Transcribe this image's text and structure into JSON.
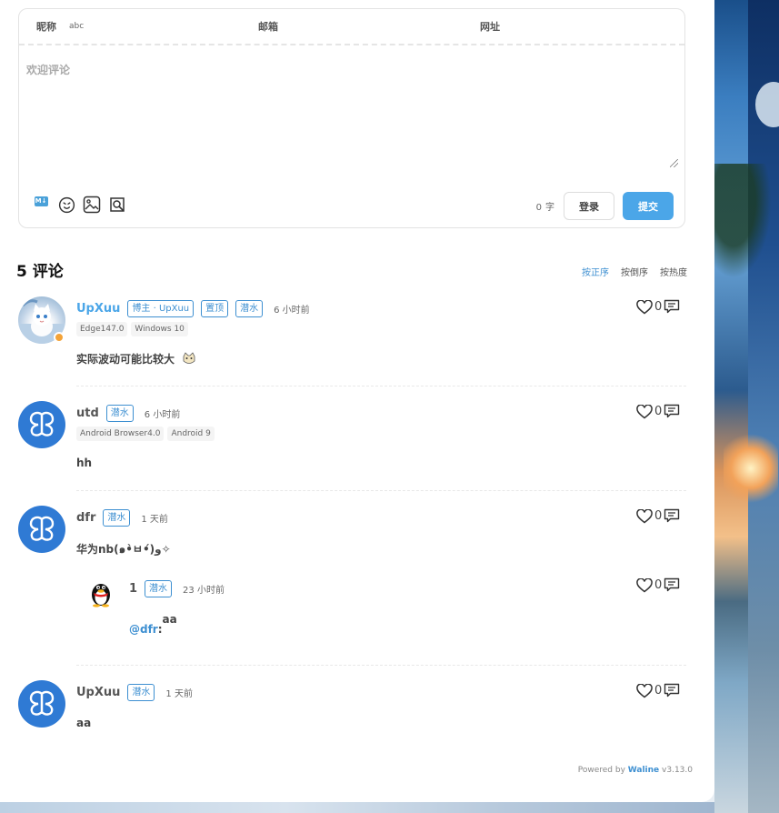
{
  "editor": {
    "nick_label": "昵称",
    "nick_value": "abc",
    "email_label": "邮箱",
    "url_label": "网址",
    "placeholder": "欢迎评论",
    "word_count": "0",
    "word_unit": "字",
    "login_label": "登录",
    "submit_label": "提交",
    "markdown_label": "M↓"
  },
  "list": {
    "count_title": "5 评论",
    "sort_options": [
      "按正序",
      "按倒序",
      "按热度"
    ],
    "active_sort": "按正序"
  },
  "comments": [
    {
      "nick": "UpXuu",
      "tags": [
        "博主 · UpXuu",
        "置顶",
        "潜水"
      ],
      "time": "6 小时前",
      "ua": [
        "Edge147.0",
        "Windows 10"
      ],
      "content": "实际波动可能比较大",
      "likes": "0",
      "avatar_icon": "cat-avatar-icon"
    },
    {
      "nick": "utd",
      "tags": [
        "潜水"
      ],
      "time": "6 小时前",
      "ua": [
        "Android Browser4.0",
        "Android 9"
      ],
      "content": "hh",
      "likes": "0",
      "avatar_icon": "butterfly-logo-avatar-icon"
    },
    {
      "nick": "dfr",
      "tags": [
        "潜水"
      ],
      "time": "1 天前",
      "content": "华为nb(๑•̀ㅂ•́)و✧",
      "likes": "0",
      "avatar_icon": "butterfly-logo-avatar-icon",
      "reply": {
        "nick": "1",
        "tags": [
          "潜水"
        ],
        "time": "23 小时前",
        "mention": "@dfr",
        "mention_sep": ":",
        "content": "aa",
        "likes": "0",
        "avatar_icon": "qq-penguin-avatar-icon"
      }
    },
    {
      "nick": "UpXuu",
      "tags": [
        "潜水"
      ],
      "time": "1 天前",
      "content": "aa",
      "likes": "0",
      "avatar_icon": "butterfly-logo-avatar-icon"
    }
  ],
  "footer": {
    "powered_prefix": "Powered by",
    "brand": "Waline",
    "version": "v3.13.0"
  },
  "colors": {
    "accent": "#3d8fd1",
    "submit_bg": "#4ba6e8",
    "logo_avatar_bg": "#2f7ad4",
    "admin_badge": "#f4a338"
  }
}
